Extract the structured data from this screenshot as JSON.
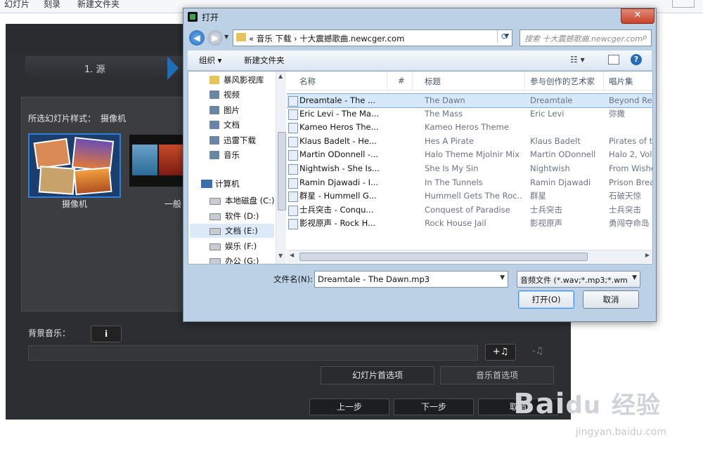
{
  "background_app": {
    "menu": [
      "幻灯片",
      "刻录",
      "新建文件夹"
    ],
    "step_label": "1. 源",
    "style_label": "所选幻灯片样式：",
    "style_value": "摄像机",
    "thumbnails": [
      {
        "label": "摄像机",
        "selected": true
      },
      {
        "label": "一般",
        "selected": false
      }
    ],
    "bgm_label": "背景音乐：",
    "info_icon": "i",
    "add_music_icon": "+♫",
    "remove_music_icon": "-♫",
    "slideshow_options": "幻灯片首选项",
    "music_options": "音乐首选项",
    "prev": "上一步",
    "next": "下一步",
    "cancel": "取消"
  },
  "dialog": {
    "title": "打开",
    "close_glyph": "✕",
    "back_glyph": "◀",
    "forward_glyph": "▶",
    "address": "« 音乐 下载 › 十大震撼歌曲.newcger.com",
    "search_placeholder": "搜索 十大震撼歌曲.newcger.com",
    "toolbar": {
      "organize": "组织 ▾",
      "new_folder": "新建文件夹",
      "view": "☷ ▾"
    },
    "nav_items": [
      {
        "label": "暴风影视库",
        "icon": "folder"
      },
      {
        "label": "视频",
        "icon": "library"
      },
      {
        "label": "图片",
        "icon": "library"
      },
      {
        "label": "文档",
        "icon": "library"
      },
      {
        "label": "迅雷下载",
        "icon": "library"
      },
      {
        "label": "音乐",
        "icon": "library"
      }
    ],
    "computer_label": "计算机",
    "drives": [
      {
        "label": "本地磁盘 (C:)",
        "selected": false
      },
      {
        "label": "软件 (D:)",
        "selected": false
      },
      {
        "label": "文档 (E:)",
        "selected": true
      },
      {
        "label": "娱乐 (F:)",
        "selected": false
      },
      {
        "label": "办公 (G:)",
        "selected": false
      }
    ],
    "columns": [
      "名称",
      "#",
      "标题",
      "参与创作的艺术家",
      "唱片集"
    ],
    "files": [
      {
        "name": "Dreamtale - The ...",
        "title": "The Dawn",
        "artist": "Dreamtale",
        "album": "Beyond Rea",
        "selected": true
      },
      {
        "name": "Eric Levi - The Ma...",
        "title": "The Mass",
        "artist": "Eric Levi",
        "album": "弥撒",
        "selected": false
      },
      {
        "name": "Kameo Heros The...",
        "title": "Kameo Heros Theme",
        "artist": "",
        "album": "",
        "selected": false
      },
      {
        "name": "Klaus Badelt - He...",
        "title": "Hes A Pirate",
        "artist": "Klaus Badelt",
        "album": "Pirates of th",
        "selected": false
      },
      {
        "name": "Martin ODonnell -...",
        "title": "Halo Theme Mjolnir Mix",
        "artist": "Martin ODonnell",
        "album": "Halo 2, Vol.",
        "selected": false
      },
      {
        "name": "Nightwish - She Is...",
        "title": "She Is My Sin",
        "artist": "Nightwish",
        "album": "From Wishe",
        "selected": false
      },
      {
        "name": "Ramin Djawadi - I...",
        "title": "In The Tunnels",
        "artist": "Ramin Djawadi",
        "album": "Prison Brea",
        "selected": false
      },
      {
        "name": "群星 - Hummell G...",
        "title": "Hummell Gets The Roc...",
        "artist": "群星",
        "album": "石破天惊",
        "selected": false
      },
      {
        "name": "士兵突击 - Conqu...",
        "title": "Conquest of Paradise",
        "artist": "士兵突击",
        "album": "士兵突击",
        "selected": false
      },
      {
        "name": "影视原声 - Rock H...",
        "title": "Rock House Jail",
        "artist": "影视原声",
        "album": "勇闯夺命岛",
        "selected": false
      }
    ],
    "filename_label": "文件名(N):",
    "filename_value": "Dreamtale - The Dawn.mp3",
    "filetype_value": "音频文件 (*.wav;*.mp3;*.wma",
    "open_button": "打开(O)",
    "cancel_button": "取消"
  },
  "watermark": {
    "text": "Bai",
    "du": "du",
    "jy": "经验",
    "url": "jingyan.baidu.com"
  }
}
